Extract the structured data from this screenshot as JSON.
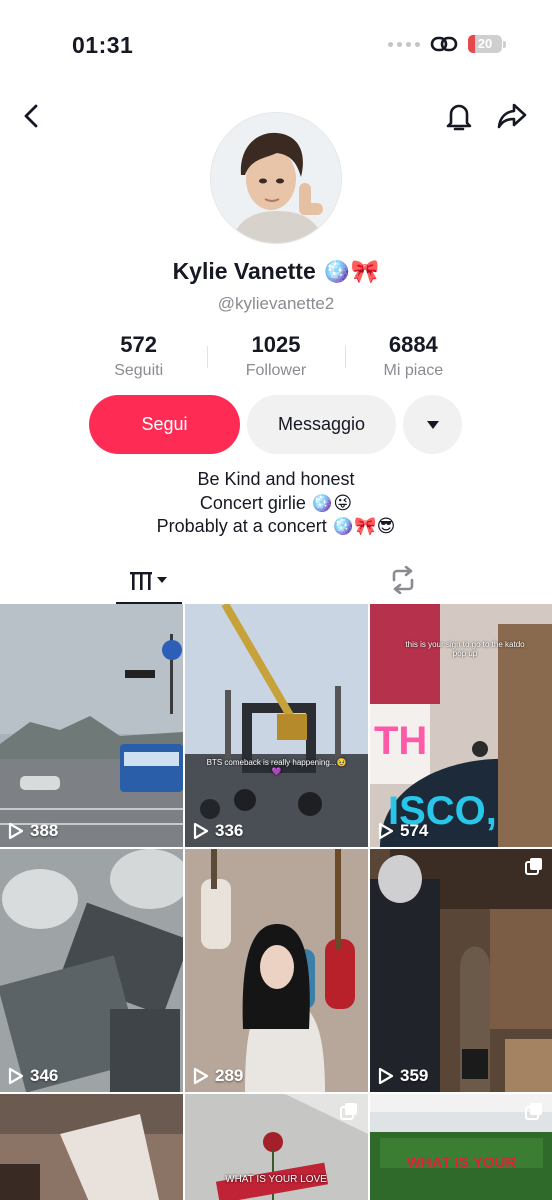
{
  "status_bar": {
    "time": "01:31",
    "battery": "20",
    "battery_level": 0.2,
    "link_icon": "link-icon",
    "battery_color": "#e5484d"
  },
  "header": {
    "back_icon": "chevron-left-icon",
    "bell_icon": "bell-icon",
    "share_icon": "share-icon"
  },
  "profile": {
    "name": "Kylie Vanette",
    "name_emoji": "🪩🎀",
    "handle": "@kylievanette2",
    "stats": [
      {
        "value": "572",
        "label": "Seguiti"
      },
      {
        "value": "1025",
        "label": "Follower"
      },
      {
        "value": "6884",
        "label": "Mi piace"
      }
    ],
    "follow_label": "Segui",
    "message_label": "Messaggio",
    "more_icon": "caret-down-icon",
    "bio": [
      "Be Kind and honest",
      "Concert girlie 🪩😜",
      "Probably at a concert 🪩🎀😎"
    ]
  },
  "tabs": {
    "videos_icon": "grid-icon",
    "reposts_icon": "repost-icon"
  },
  "videos": [
    {
      "views": "388"
    },
    {
      "views": "336",
      "caption": "BTS comeback is really happening...🥹💜"
    },
    {
      "views": "574",
      "caption": "this is your sign to go to the katdo pop up"
    },
    {
      "views": "346"
    },
    {
      "views": "289"
    },
    {
      "views": "359"
    },
    {
      "views": ""
    },
    {
      "views": "",
      "caption": "WHAT IS YOUR LOVE"
    },
    {
      "views": "",
      "caption": "WHAT IS YOUR"
    }
  ],
  "colors": {
    "accent": "#fe2c55",
    "muted": "#8a8b91",
    "button_bg": "#f1f1f2"
  }
}
